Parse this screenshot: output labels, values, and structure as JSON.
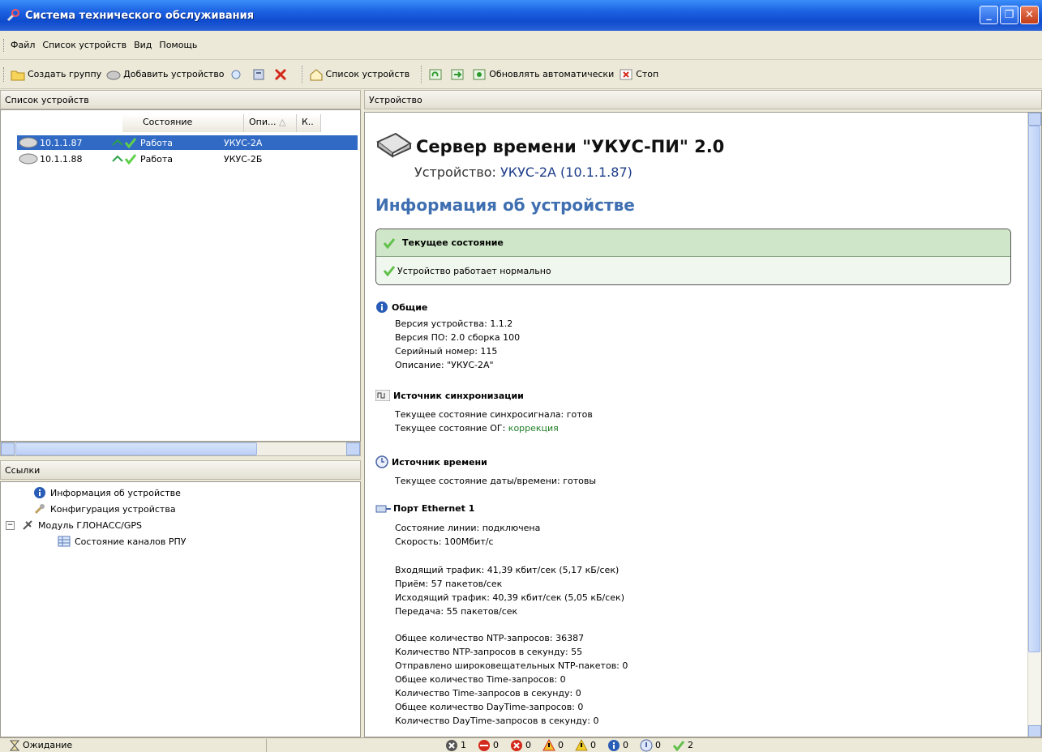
{
  "window": {
    "title": "Система технического обслуживания"
  },
  "menu": {
    "items": [
      "Файл",
      "Список устройств",
      "Вид",
      "Помощь"
    ]
  },
  "toolbar": {
    "create_group": "Создать группу",
    "add_device": "Добавить устройство",
    "device_list": "Список устройств",
    "auto_update": "Обновлять автоматически",
    "stop": "Стоп"
  },
  "left": {
    "title": "Список устройств",
    "columns": [
      "Состояние",
      "Опи...",
      "К.."
    ],
    "rows": [
      {
        "ip": "10.1.1.87",
        "state": "Работа",
        "desc": "УКУС-2А"
      },
      {
        "ip": "10.1.1.88",
        "state": "Работа",
        "desc": "УКУС-2Б"
      }
    ],
    "links_title": "Ссылки",
    "links": [
      "Информация об устройстве",
      "Конфигурация устройства",
      "Модуль ГЛОНАСС/GPS",
      "Состояние каналов РПУ"
    ]
  },
  "right": {
    "panel_title": "Устройство",
    "heading": "Сервер времени \"УКУС-ПИ\" 2.0",
    "device_label": "Устройство:",
    "device_value": "УКУС-2А (10.1.1.87)",
    "section_title": "Информация об устройстве",
    "state_header": "Текущее состояние",
    "state_text": "Устройство работает нормально",
    "general": {
      "title": "Общие",
      "lines": [
        "Версия устройства: 1.1.2",
        "Версия ПО: 2.0 сборка 100",
        "Серийный номер: 115",
        "Описание: \"УКУС-2А\""
      ]
    },
    "sync": {
      "title": "Источник синхронизации",
      "line1": "Текущее состояние синхросигнала: готов",
      "line2_label": "Текущее состояние ОГ:",
      "line2_value": "коррекция"
    },
    "time": {
      "title": "Источник времени",
      "line": "Текущее состояние даты/времени: готовы"
    },
    "ethernet": {
      "title": "Порт Ethernet 1",
      "link": [
        "Состояние линии: подключена",
        "Скорость: 100Мбит/с"
      ],
      "traffic": [
        "Входящий трафик: 41,39 кбит/сек (5,17 кБ/сек)",
        "Приём: 57 пакетов/сек",
        "Исходящий трафик: 40,39 кбит/сек (5,05 кБ/сек)",
        "Передача: 55 пакетов/сек"
      ],
      "ntp": [
        "Общее количество NTP-запросов: 36387",
        "Количество NTP-запросов в секунду: 55",
        "Отправлено широковещательных NTP-пакетов: 0",
        "Общее количество Time-запросов: 0",
        "Количество Time-запросов в секунду: 0",
        "Общее количество DayTime-запросов: 0",
        "Количество DayTime-запросов в секунду: 0"
      ]
    }
  },
  "status": {
    "text": "Ожидание",
    "counts": [
      "1",
      "0",
      "0",
      "0",
      "0",
      "0",
      "0",
      "2"
    ]
  }
}
